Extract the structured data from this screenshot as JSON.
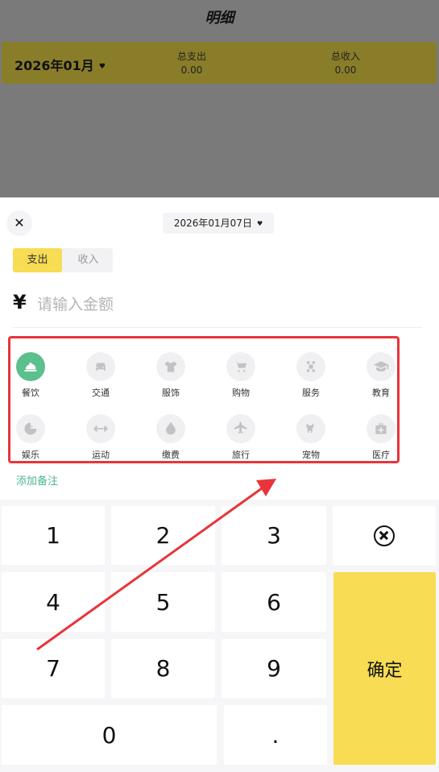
{
  "header": {
    "title": "明细",
    "month": "2026年01月",
    "expense_label": "总支出",
    "expense_value": "0.00",
    "income_label": "总收入",
    "income_value": "0.00"
  },
  "sheet": {
    "close_icon": "close-icon",
    "date": "2026年01月07日",
    "tabs": [
      {
        "label": "支出",
        "active": true
      },
      {
        "label": "收入",
        "active": false
      }
    ],
    "currency": "¥",
    "amount_placeholder": "请输入金额",
    "categories": [
      {
        "label": "餐饮",
        "icon": "dining-icon",
        "selected": true
      },
      {
        "label": "交通",
        "icon": "car-icon"
      },
      {
        "label": "服饰",
        "icon": "shirt-icon"
      },
      {
        "label": "购物",
        "icon": "cart-icon"
      },
      {
        "label": "服务",
        "icon": "service-icon"
      },
      {
        "label": "教育",
        "icon": "graduation-cap-icon"
      },
      {
        "label": "娱乐",
        "icon": "game-icon"
      },
      {
        "label": "运动",
        "icon": "dumbbell-icon"
      },
      {
        "label": "缴费",
        "icon": "bill-icon"
      },
      {
        "label": "旅行",
        "icon": "airplane-icon"
      },
      {
        "label": "宠物",
        "icon": "pet-icon"
      },
      {
        "label": "医疗",
        "icon": "medical-kit-icon"
      }
    ],
    "add_note": "添加备注"
  },
  "keypad": {
    "keys": [
      "1",
      "2",
      "3",
      "4",
      "5",
      "6",
      "7",
      "8",
      "9",
      "0",
      "."
    ],
    "confirm": "确定",
    "backspace_icon": "backspace-icon"
  },
  "colors": {
    "accent_yellow": "#f7dc54",
    "selected_green": "#5cbf8e",
    "annotation_red": "#e8343a"
  }
}
